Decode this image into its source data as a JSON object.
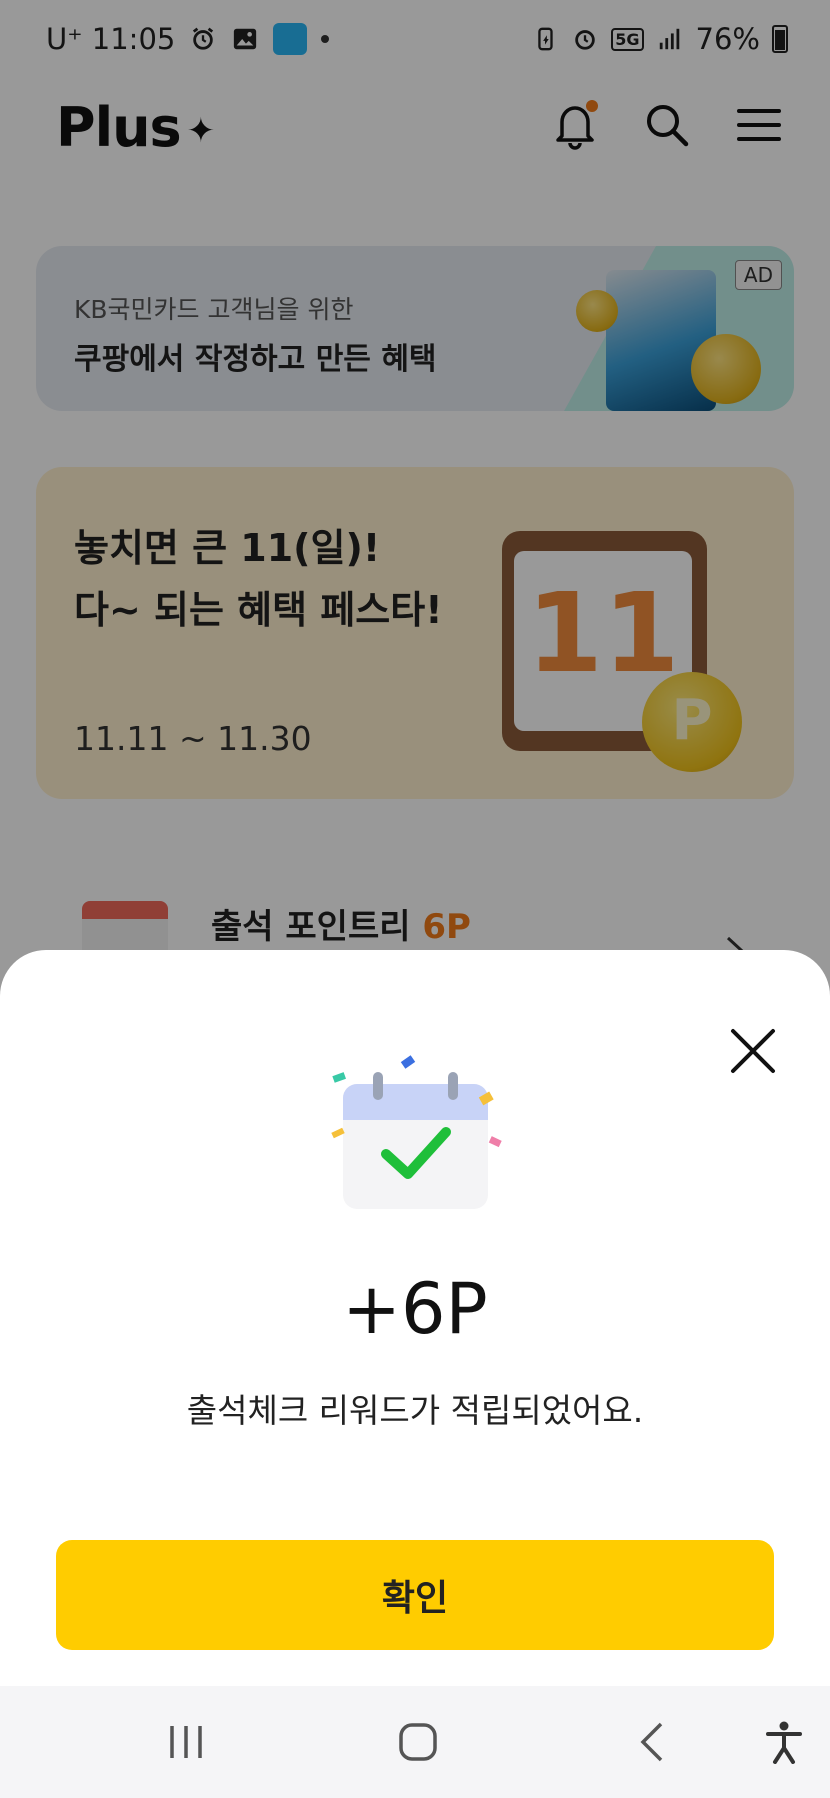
{
  "status_bar": {
    "carrier": "U⁺",
    "time": "11:05",
    "battery": "76%",
    "network": "5G"
  },
  "header": {
    "logo": "Plus",
    "logo_mark": "✦",
    "icons": [
      "bell-icon",
      "search-icon",
      "menu-icon"
    ]
  },
  "ad_banner": {
    "subtitle": "KB국민카드 고객님을 위한",
    "title": "쿠팡에서 작정하고 만든 혜택",
    "badge": "AD"
  },
  "promo_banner": {
    "line1": "놓치면 큰 11(일)!",
    "line2": "다~ 되는 혜택 페스타!",
    "date_range": "11.11 ~ 11.30",
    "calendar_number": "11",
    "coin_letter": "P"
  },
  "attendance_card": {
    "title": "출석 포인트리",
    "points": "6P"
  },
  "reward_sheet": {
    "value": "+6P",
    "message": "출석체크 리워드가 적립되었어요.",
    "confirm_label": "확인"
  },
  "colors": {
    "accent_yellow": "#ffcc00",
    "check_green": "#1fbf3a",
    "points_orange": "#f07b1a"
  }
}
